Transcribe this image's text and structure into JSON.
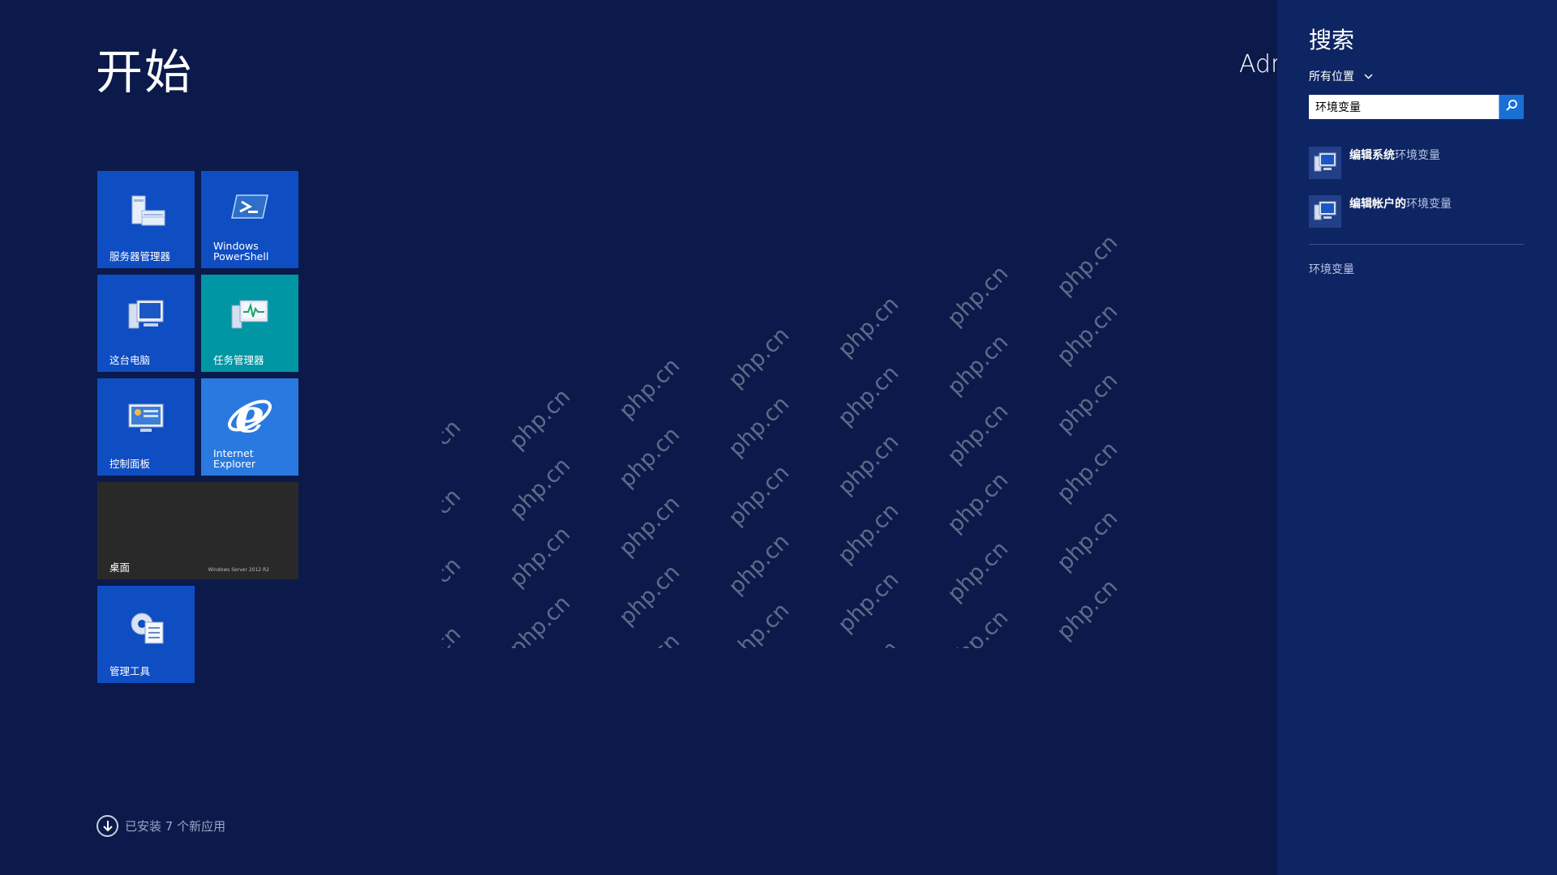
{
  "start": {
    "title": "开始",
    "user_name": "Administrator",
    "apps_link": "已安装 7 个新应用"
  },
  "tiles": [
    {
      "id": "server-manager",
      "label": "服务器管理器",
      "icon": "server-manager-icon"
    },
    {
      "id": "powershell",
      "label": "Windows\nPowerShell",
      "icon": "powershell-icon"
    },
    {
      "id": "this-pc",
      "label": "这台电脑",
      "icon": "computer-icon"
    },
    {
      "id": "task-manager",
      "label": "任务管理器",
      "icon": "task-manager-icon"
    },
    {
      "id": "control-panel",
      "label": "控制面板",
      "icon": "control-panel-icon"
    },
    {
      "id": "ie",
      "label": "Internet\nExplorer",
      "icon": "internet-explorer-icon"
    },
    {
      "id": "desktop",
      "label": "桌面",
      "icon": "desktop-icon",
      "brand": "Windows Server 2012 R2"
    },
    {
      "id": "admin-tools",
      "label": "管理工具",
      "icon": "admin-tools-icon"
    }
  ],
  "watermark": {
    "text": "php.cn"
  },
  "search": {
    "title": "搜索",
    "scope": "所有位置",
    "query": "环境变量",
    "results": [
      {
        "prefix": "编辑系统",
        "match": "环境变量"
      },
      {
        "prefix": "编辑帐户的",
        "match": "环境变量"
      }
    ],
    "suggestion": "环境变量"
  },
  "colors": {
    "start_bg": "#0b1a4a",
    "search_pane_bg": "#0e2563",
    "tile_blue": "#0f4dc3",
    "tile_teal": "#0096a3",
    "tile_ie": "#2a79e0",
    "tile_desktop": "#292929"
  }
}
